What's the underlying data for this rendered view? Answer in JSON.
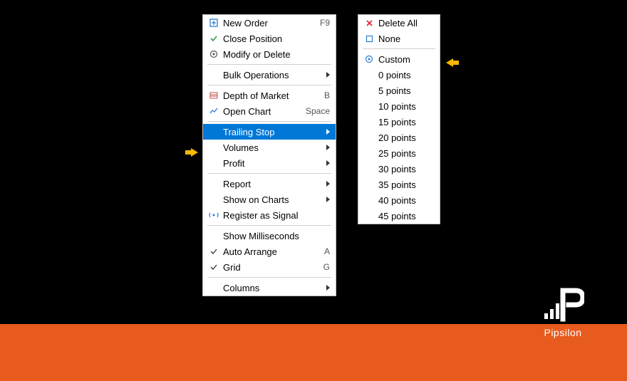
{
  "menu1": {
    "new_order": {
      "label": "New Order",
      "shortcut": "F9"
    },
    "close_position": {
      "label": "Close Position"
    },
    "modify_delete": {
      "label": "Modify or Delete"
    },
    "bulk_operations": {
      "label": "Bulk Operations"
    },
    "depth_of_market": {
      "label": "Depth of Market",
      "shortcut": "B"
    },
    "open_chart": {
      "label": "Open Chart",
      "shortcut": "Space"
    },
    "trailing_stop": {
      "label": "Trailing Stop"
    },
    "volumes": {
      "label": "Volumes"
    },
    "profit": {
      "label": "Profit"
    },
    "report": {
      "label": "Report"
    },
    "show_on_charts": {
      "label": "Show on Charts"
    },
    "register_signal": {
      "label": "Register as Signal"
    },
    "show_ms": {
      "label": "Show Milliseconds"
    },
    "auto_arrange": {
      "label": "Auto Arrange",
      "shortcut": "A"
    },
    "grid": {
      "label": "Grid",
      "shortcut": "G"
    },
    "columns": {
      "label": "Columns"
    }
  },
  "menu2": {
    "delete_all": {
      "label": "Delete All"
    },
    "none": {
      "label": "None"
    },
    "custom": {
      "label": "Custom"
    },
    "points": [
      {
        "label": "0 points"
      },
      {
        "label": "5 points"
      },
      {
        "label": "10 points"
      },
      {
        "label": "15 points"
      },
      {
        "label": "20 points"
      },
      {
        "label": "25 points"
      },
      {
        "label": "30 points"
      },
      {
        "label": "35 points"
      },
      {
        "label": "40 points"
      },
      {
        "label": "45 points"
      }
    ]
  },
  "brand": {
    "name": "Pipsilon"
  },
  "colors": {
    "highlight": "#0078d7",
    "accent": "#e85b1e",
    "arrow": "#f9b600"
  }
}
